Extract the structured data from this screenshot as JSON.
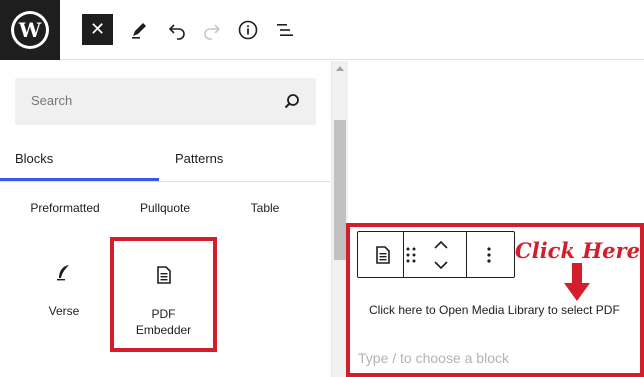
{
  "toolbar": {
    "logo_icon": "wordpress-logo-icon",
    "logo_letter": "W",
    "close_glyph": "✕",
    "icons": [
      "close-icon",
      "pen-icon",
      "undo-icon",
      "redo-icon",
      "info-icon",
      "document-outline-icon"
    ]
  },
  "inserter": {
    "search_placeholder": "Search",
    "tabs": [
      {
        "label": "Blocks",
        "active": true
      },
      {
        "label": "Patterns",
        "active": false
      }
    ],
    "blocks_row1": [
      "Preformatted",
      "Pullquote",
      "Table"
    ],
    "verse": {
      "label": "Verse",
      "icon": "feather-icon"
    },
    "pdf_embedder": {
      "label_line1": "PDF",
      "label_line2": "Embedder",
      "icon": "document-icon"
    }
  },
  "editor": {
    "annotation": "Click Here",
    "media_hint": "Click here to Open Media Library to select PDF",
    "block_placeholder": "Type / to choose a block"
  },
  "colors": {
    "accent": "#3858e9",
    "highlight_red": "#d51e2c",
    "dark": "#1e1e1e"
  }
}
